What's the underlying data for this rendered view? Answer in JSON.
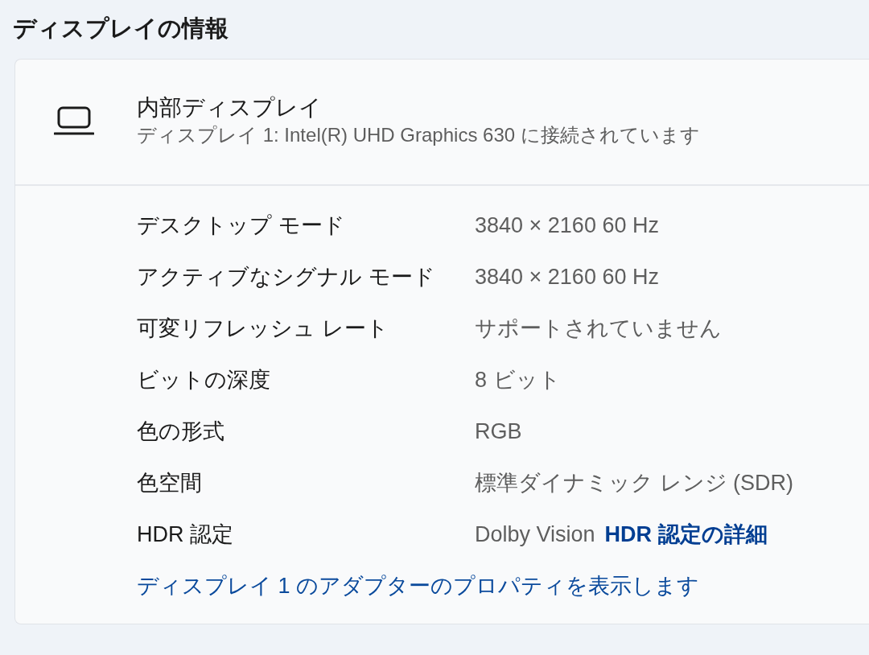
{
  "section_title": "ディスプレイの情報",
  "display": {
    "name": "内部ディスプレイ",
    "description": "ディスプレイ 1: Intel(R) UHD Graphics 630 に接続されています"
  },
  "properties": [
    {
      "label": "デスクトップ モード",
      "value": "3840 × 2160 60 Hz"
    },
    {
      "label": "アクティブなシグナル モード",
      "value": "3840 × 2160 60 Hz"
    },
    {
      "label": "可変リフレッシュ レート",
      "value": "サポートされていません"
    },
    {
      "label": "ビットの深度",
      "value": "8 ビット"
    },
    {
      "label": "色の形式",
      "value": "RGB"
    },
    {
      "label": "色空間",
      "value": "標準ダイナミック レンジ (SDR)"
    },
    {
      "label": "HDR 認定",
      "value": "Dolby Vision",
      "link": "HDR 認定の詳細"
    }
  ],
  "adapter_link": "ディスプレイ 1 のアダプターのプロパティを表示します"
}
